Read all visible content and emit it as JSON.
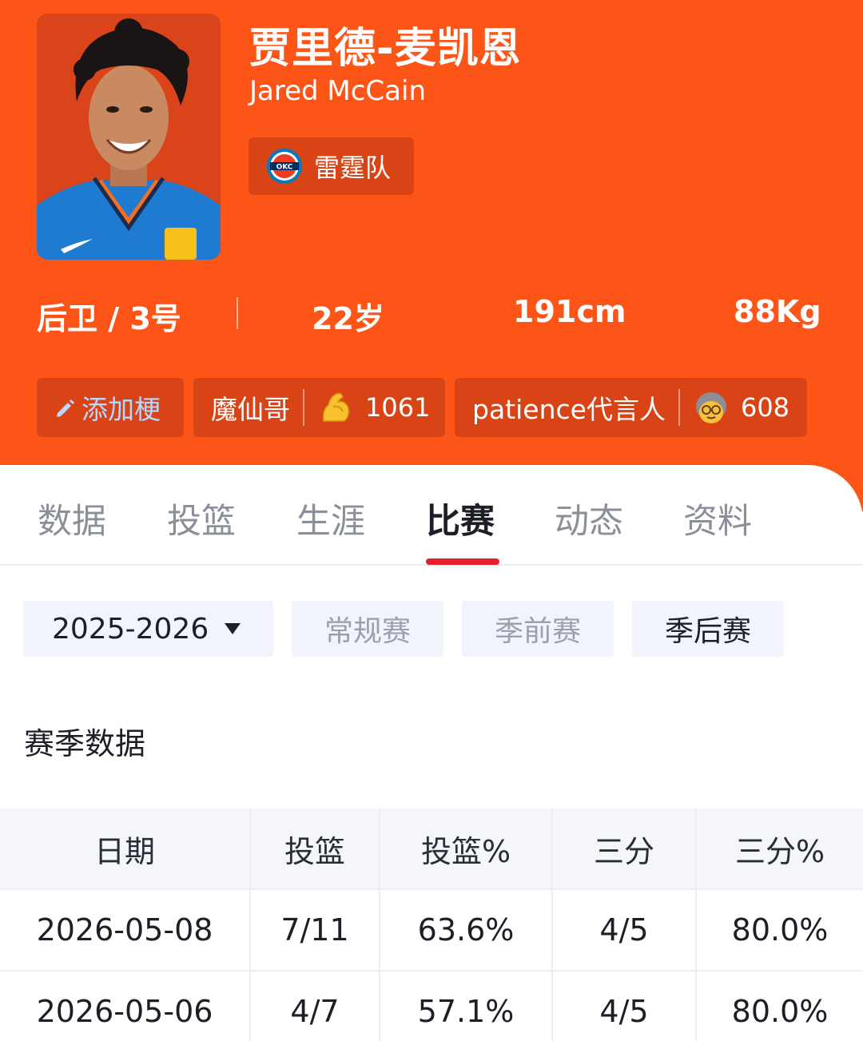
{
  "player": {
    "name_cn": "贾里德-麦凯恩",
    "name_en": "Jared McCain",
    "team": "雷霆队",
    "team_logo_text": "OKC",
    "position_number": "后卫 / 3号",
    "age": "22岁",
    "height": "191cm",
    "weight": "88Kg"
  },
  "tags": {
    "add_label": "添加梗",
    "items": [
      {
        "label": "魔仙哥",
        "emoji": "flexed-biceps-icon",
        "count": "1061"
      },
      {
        "label": "patience代言人",
        "emoji": "grandma-face-icon",
        "count": "608"
      }
    ]
  },
  "tabs": [
    {
      "label": "数据",
      "active": false
    },
    {
      "label": "投篮",
      "active": false
    },
    {
      "label": "生涯",
      "active": false
    },
    {
      "label": "比赛",
      "active": true
    },
    {
      "label": "动态",
      "active": false
    },
    {
      "label": "资料",
      "active": false
    }
  ],
  "filters": {
    "season": "2025-2026",
    "types": [
      "常规赛",
      "季前赛",
      "季后赛"
    ],
    "selected_type": "季后赛"
  },
  "section_title": "赛季数据",
  "table": {
    "headers": [
      "日期",
      "投篮",
      "投篮%",
      "三分",
      "三分%"
    ],
    "rows": [
      [
        "2026-05-08",
        "7/11",
        "63.6%",
        "4/5",
        "80.0%"
      ],
      [
        "2026-05-06",
        "4/7",
        "57.1%",
        "4/5",
        "80.0%"
      ]
    ]
  },
  "colors": {
    "header_bg": "#fd5518",
    "chip_bg": "#d94417",
    "accent_red": "#e8202e",
    "filter_bg": "#f1f4fb"
  }
}
